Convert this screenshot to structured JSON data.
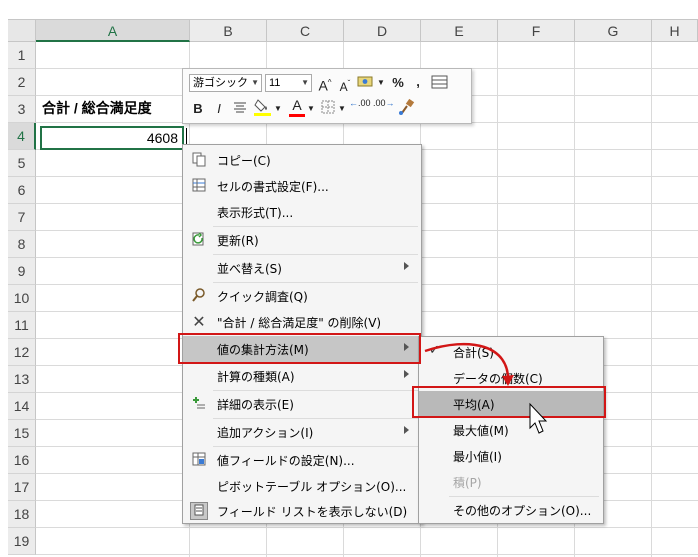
{
  "spreadsheet": {
    "columns": [
      "A",
      "B",
      "C",
      "D",
      "E",
      "F",
      "G",
      "H"
    ],
    "rows": [
      "1",
      "2",
      "3",
      "4",
      "5",
      "6",
      "7",
      "8",
      "9",
      "10",
      "11",
      "12",
      "13",
      "14",
      "15",
      "16",
      "17",
      "18",
      "19"
    ],
    "active_column": "A",
    "active_row": "4",
    "cells": {
      "A3": "合計 / 総合満足度",
      "A4": "4608"
    }
  },
  "mini_toolbar": {
    "font_name": "游ゴシック",
    "font_size": "11",
    "increase_font_label": "A",
    "decrease_font_label": "A",
    "percent_label": "%",
    "comma_label": ",",
    "bold_label": "B",
    "italic_label": "I",
    "font_color_label": "A",
    "increase_decimal_label": ".00",
    "decrease_decimal_label": ".00",
    "highlight_color": "#ffff00",
    "font_color": "#ff0000"
  },
  "context_menu": {
    "items": [
      {
        "label": "コピー(C)",
        "icon": "copy-icon"
      },
      {
        "label": "セルの書式設定(F)...",
        "icon": "format-cells-icon"
      },
      {
        "label": "表示形式(T)...",
        "icon": ""
      },
      {
        "label": "更新(R)",
        "icon": "refresh-icon"
      },
      {
        "label": "並べ替え(S)",
        "icon": ""
      },
      {
        "label": "クイック調査(Q)",
        "icon": "quick-explore-icon"
      },
      {
        "label": "\"合計 / 総合満足度\" の削除(V)",
        "icon": "delete-x-icon"
      },
      {
        "label": "値の集計方法(M)",
        "icon": ""
      },
      {
        "label": "計算の種類(A)",
        "icon": ""
      },
      {
        "label": "詳細の表示(E)",
        "icon": "show-details-icon"
      },
      {
        "label": "追加アクション(I)",
        "icon": ""
      },
      {
        "label": "値フィールドの設定(N)...",
        "icon": "field-settings-icon"
      },
      {
        "label": "ピボットテーブル オプション(O)...",
        "icon": ""
      },
      {
        "label": "フィールド リストを表示しない(D)",
        "icon": "field-list-icon"
      }
    ]
  },
  "submenu": {
    "items": [
      {
        "label": "合計(S)",
        "checked": true,
        "disabled": false
      },
      {
        "label": "データの個数(C)",
        "checked": false,
        "disabled": false
      },
      {
        "label": "平均(A)",
        "checked": false,
        "disabled": false
      },
      {
        "label": "最大値(M)",
        "checked": false,
        "disabled": false
      },
      {
        "label": "最小値(I)",
        "checked": false,
        "disabled": false
      },
      {
        "label": "積(P)",
        "checked": false,
        "disabled": true
      },
      {
        "label": "その他のオプション(O)...",
        "checked": false,
        "disabled": false
      }
    ]
  },
  "colors": {
    "accent_green": "#217346",
    "annotation_red": "#d21616"
  }
}
